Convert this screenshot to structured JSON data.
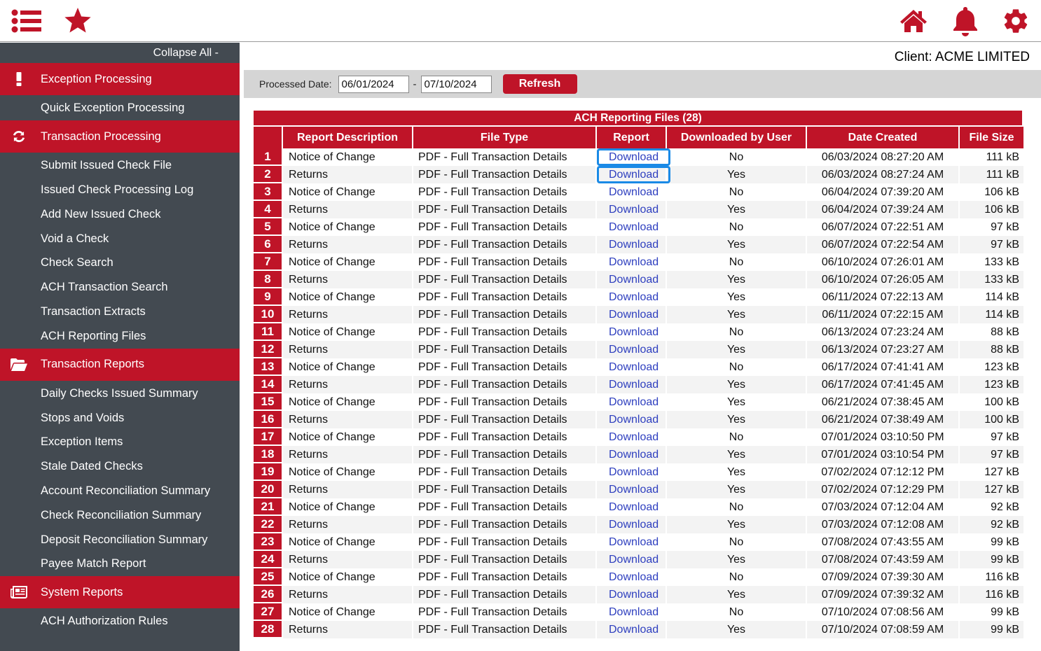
{
  "topbar": {
    "left_icons": [
      "menu-list-icon",
      "favorites-star-icon"
    ],
    "right_icons": [
      "home-icon",
      "notifications-bell-icon",
      "settings-gear-icon"
    ]
  },
  "sidebar": {
    "collapse_label": "Collapse All -",
    "sections": [
      {
        "label": "Exception Processing",
        "icon": "exclamation-icon",
        "items": [
          "Quick Exception Processing"
        ]
      },
      {
        "label": "Transaction Processing",
        "icon": "refresh-icon",
        "items": [
          "Submit Issued Check File",
          "Issued Check Processing Log",
          "Add New Issued Check",
          "Void a Check",
          "Check Search",
          "ACH Transaction Search",
          "Transaction Extracts",
          "ACH Reporting Files"
        ]
      },
      {
        "label": "Transaction Reports",
        "icon": "folder-open-icon",
        "items": [
          "Daily Checks Issued Summary",
          "Stops and Voids",
          "Exception Items",
          "Stale Dated Checks",
          "Account Reconciliation Summary",
          "Check Reconciliation Summary",
          "Deposit Reconciliation Summary",
          "Payee Match Report"
        ]
      },
      {
        "label": "System Reports",
        "icon": "newspaper-icon",
        "items": [
          "ACH Authorization Rules"
        ]
      }
    ]
  },
  "main": {
    "client_label": "Client: ACME LIMITED",
    "filter": {
      "label": "Processed Date:",
      "date_from": "06/01/2024",
      "separator": "-",
      "date_to": "07/10/2024",
      "refresh_label": "Refresh"
    },
    "table": {
      "title": "ACH Reporting Files (28)",
      "columns": [
        "",
        "Report Description",
        "File Type",
        "Report",
        "Downloaded by User",
        "Date Created",
        "File Size"
      ],
      "rows": [
        [
          "1",
          "Notice of Change",
          "PDF - Full Transaction Details",
          "Download",
          "No",
          "06/03/2024 08:27:20 AM",
          "111 kB"
        ],
        [
          "2",
          "Returns",
          "PDF - Full Transaction Details",
          "Download",
          "Yes",
          "06/03/2024 08:27:24 AM",
          "111 kB"
        ],
        [
          "3",
          "Notice of Change",
          "PDF - Full Transaction Details",
          "Download",
          "No",
          "06/04/2024 07:39:20 AM",
          "106 kB"
        ],
        [
          "4",
          "Returns",
          "PDF - Full Transaction Details",
          "Download",
          "Yes",
          "06/04/2024 07:39:24 AM",
          "106 kB"
        ],
        [
          "5",
          "Notice of Change",
          "PDF - Full Transaction Details",
          "Download",
          "No",
          "06/07/2024 07:22:51 AM",
          "97 kB"
        ],
        [
          "6",
          "Returns",
          "PDF - Full Transaction Details",
          "Download",
          "Yes",
          "06/07/2024 07:22:54 AM",
          "97 kB"
        ],
        [
          "7",
          "Notice of Change",
          "PDF - Full Transaction Details",
          "Download",
          "No",
          "06/10/2024 07:26:01 AM",
          "133 kB"
        ],
        [
          "8",
          "Returns",
          "PDF - Full Transaction Details",
          "Download",
          "Yes",
          "06/10/2024 07:26:05 AM",
          "133 kB"
        ],
        [
          "9",
          "Notice of Change",
          "PDF - Full Transaction Details",
          "Download",
          "Yes",
          "06/11/2024 07:22:13 AM",
          "114 kB"
        ],
        [
          "10",
          "Returns",
          "PDF - Full Transaction Details",
          "Download",
          "Yes",
          "06/11/2024 07:22:15 AM",
          "114 kB"
        ],
        [
          "11",
          "Notice of Change",
          "PDF - Full Transaction Details",
          "Download",
          "No",
          "06/13/2024 07:23:24 AM",
          "88 kB"
        ],
        [
          "12",
          "Returns",
          "PDF - Full Transaction Details",
          "Download",
          "Yes",
          "06/13/2024 07:23:27 AM",
          "88 kB"
        ],
        [
          "13",
          "Notice of Change",
          "PDF - Full Transaction Details",
          "Download",
          "No",
          "06/17/2024 07:41:41 AM",
          "123 kB"
        ],
        [
          "14",
          "Returns",
          "PDF - Full Transaction Details",
          "Download",
          "Yes",
          "06/17/2024 07:41:45 AM",
          "123 kB"
        ],
        [
          "15",
          "Notice of Change",
          "PDF - Full Transaction Details",
          "Download",
          "Yes",
          "06/21/2024 07:38:45 AM",
          "100 kB"
        ],
        [
          "16",
          "Returns",
          "PDF - Full Transaction Details",
          "Download",
          "Yes",
          "06/21/2024 07:38:49 AM",
          "100 kB"
        ],
        [
          "17",
          "Notice of Change",
          "PDF - Full Transaction Details",
          "Download",
          "No",
          "07/01/2024 03:10:50 PM",
          "97 kB"
        ],
        [
          "18",
          "Returns",
          "PDF - Full Transaction Details",
          "Download",
          "Yes",
          "07/01/2024 03:10:54 PM",
          "97 kB"
        ],
        [
          "19",
          "Notice of Change",
          "PDF - Full Transaction Details",
          "Download",
          "Yes",
          "07/02/2024 07:12:12 PM",
          "127 kB"
        ],
        [
          "20",
          "Returns",
          "PDF - Full Transaction Details",
          "Download",
          "Yes",
          "07/02/2024 07:12:29 PM",
          "127 kB"
        ],
        [
          "21",
          "Notice of Change",
          "PDF - Full Transaction Details",
          "Download",
          "No",
          "07/03/2024 07:12:04 AM",
          "92 kB"
        ],
        [
          "22",
          "Returns",
          "PDF - Full Transaction Details",
          "Download",
          "Yes",
          "07/03/2024 07:12:08 AM",
          "92 kB"
        ],
        [
          "23",
          "Notice of Change",
          "PDF - Full Transaction Details",
          "Download",
          "No",
          "07/08/2024 07:43:55 AM",
          "99 kB"
        ],
        [
          "24",
          "Returns",
          "PDF - Full Transaction Details",
          "Download",
          "Yes",
          "07/08/2024 07:43:59 AM",
          "99 kB"
        ],
        [
          "25",
          "Notice of Change",
          "PDF - Full Transaction Details",
          "Download",
          "No",
          "07/09/2024 07:39:30 AM",
          "116 kB"
        ],
        [
          "26",
          "Returns",
          "PDF - Full Transaction Details",
          "Download",
          "Yes",
          "07/09/2024 07:39:32 AM",
          "116 kB"
        ],
        [
          "27",
          "Notice of Change",
          "PDF - Full Transaction Details",
          "Download",
          "No",
          "07/10/2024 07:08:56 AM",
          "99 kB"
        ],
        [
          "28",
          "Returns",
          "PDF - Full Transaction Details",
          "Download",
          "Yes",
          "07/10/2024 07:08:59 AM",
          "99 kB"
        ]
      ],
      "highlighted_rows": [
        1,
        2
      ]
    }
  },
  "colors": {
    "brand_red": "#bf1428",
    "sidebar_bg": "#434a51",
    "link_blue": "#2e3fbf",
    "focus_ring": "#1a8ae6",
    "filter_bar_bg": "#d5d5d5"
  }
}
